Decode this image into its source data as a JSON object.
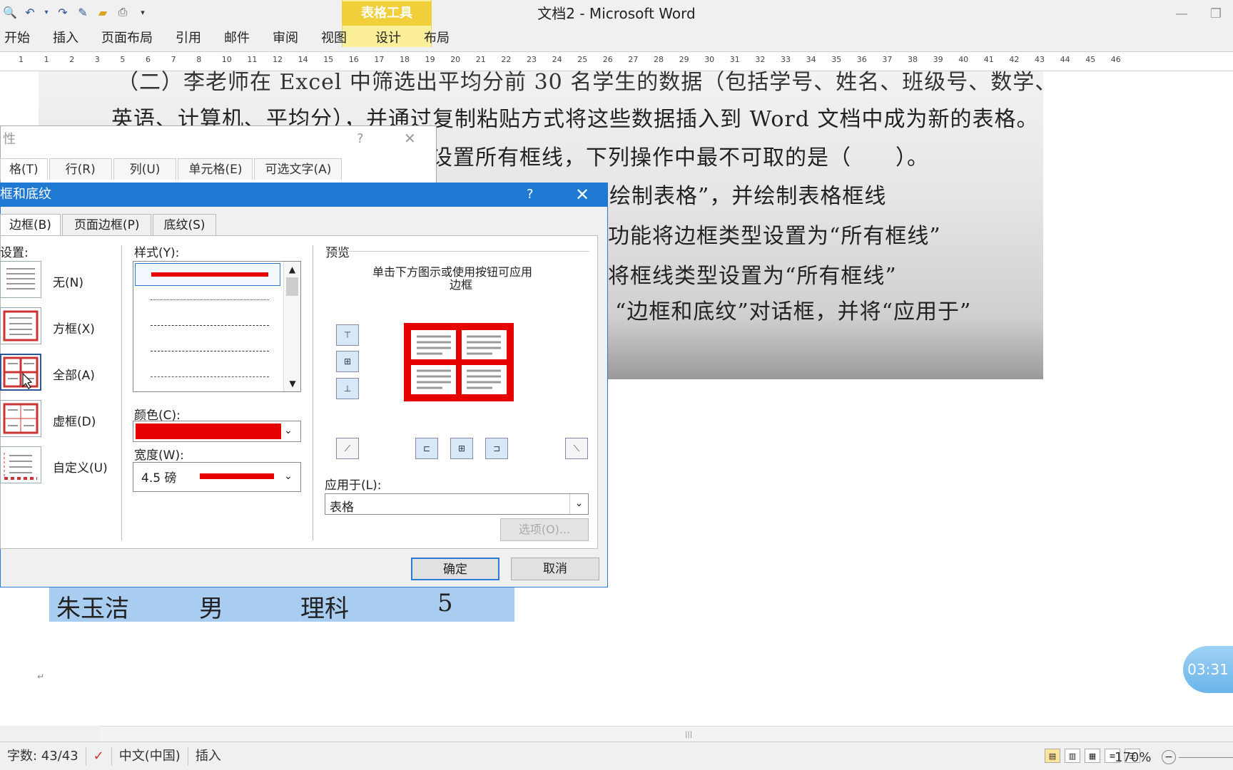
{
  "window": {
    "title": "文档2 - Microsoft Word",
    "minimize": "—",
    "restore": "❐"
  },
  "ribbon": {
    "context_label": "表格工具",
    "tabs": [
      "开始",
      "插入",
      "页面布局",
      "引用",
      "邮件",
      "审阅",
      "视图",
      "设计",
      "布局"
    ]
  },
  "ruler": {
    "ticks": [
      "1",
      "1",
      "2",
      "3",
      "5",
      "6",
      "7",
      "8",
      "10",
      "11",
      "12",
      "14",
      "15",
      "16",
      "17",
      "18",
      "19",
      "20",
      "21",
      "22",
      "23",
      "24",
      "25",
      "26",
      "27",
      "28",
      "29",
      "30",
      "31",
      "32",
      "33",
      "34",
      "35",
      "36",
      "37",
      "38",
      "39",
      "40",
      "41",
      "42",
      "43",
      "44",
      "45",
      "46"
    ]
  },
  "photo": {
    "lines": [
      "（二）李老师在 Excel 中筛选出平均分前 30 名学生的数据（包括学号、姓名、班级号、数学、",
      "英语、计算机、平均分），并通过复制粘贴方式将这些数据插入到 Word 文档中成为新的表格。",
      "设置所有框线，下列操作中最不可取的是（　　）。",
      "绘制表格”，并绘制表格框线",
      "功能将边框类型设置为“所有框线”",
      "将框线类型设置为“所有框线”",
      "“边框和底纹”对话框，并将“应用于”"
    ]
  },
  "table_row": {
    "cells": [
      "朱玉洁",
      "男",
      "理科",
      "5"
    ]
  },
  "back_dialog": {
    "title": "性",
    "help": "?",
    "close": "✕",
    "tabs": [
      "格(T)",
      "行(R)",
      "列(U)",
      "单元格(E)",
      "可选文字(A)"
    ]
  },
  "dialog": {
    "title": "框和底纹",
    "help": "?",
    "close": "✕",
    "tabs": [
      "边框(B)",
      "页面边框(P)",
      "底纹(S)"
    ],
    "settings_label": "设置:",
    "settings": [
      "无(N)",
      "方框(X)",
      "全部(A)",
      "虚框(D)",
      "自定义(U)"
    ],
    "style_label": "样式(Y):",
    "color_label": "颜色(C):",
    "width_label": "宽度(W):",
    "width_value": "4.5 磅",
    "preview_label": "预览",
    "preview_hint_1": "单击下方图示或使用按钮可应用",
    "preview_hint_2": "边框",
    "apply_label": "应用于(L):",
    "apply_value": "表格",
    "options_button": "选项(O)...",
    "ok_button": "确定",
    "cancel_button": "取消",
    "border_color": "#e60000"
  },
  "status": {
    "word_count": "字数: 43/43",
    "language": "中文(中国)",
    "mode": "插入",
    "zoom": "170%"
  },
  "timer": "03:31"
}
